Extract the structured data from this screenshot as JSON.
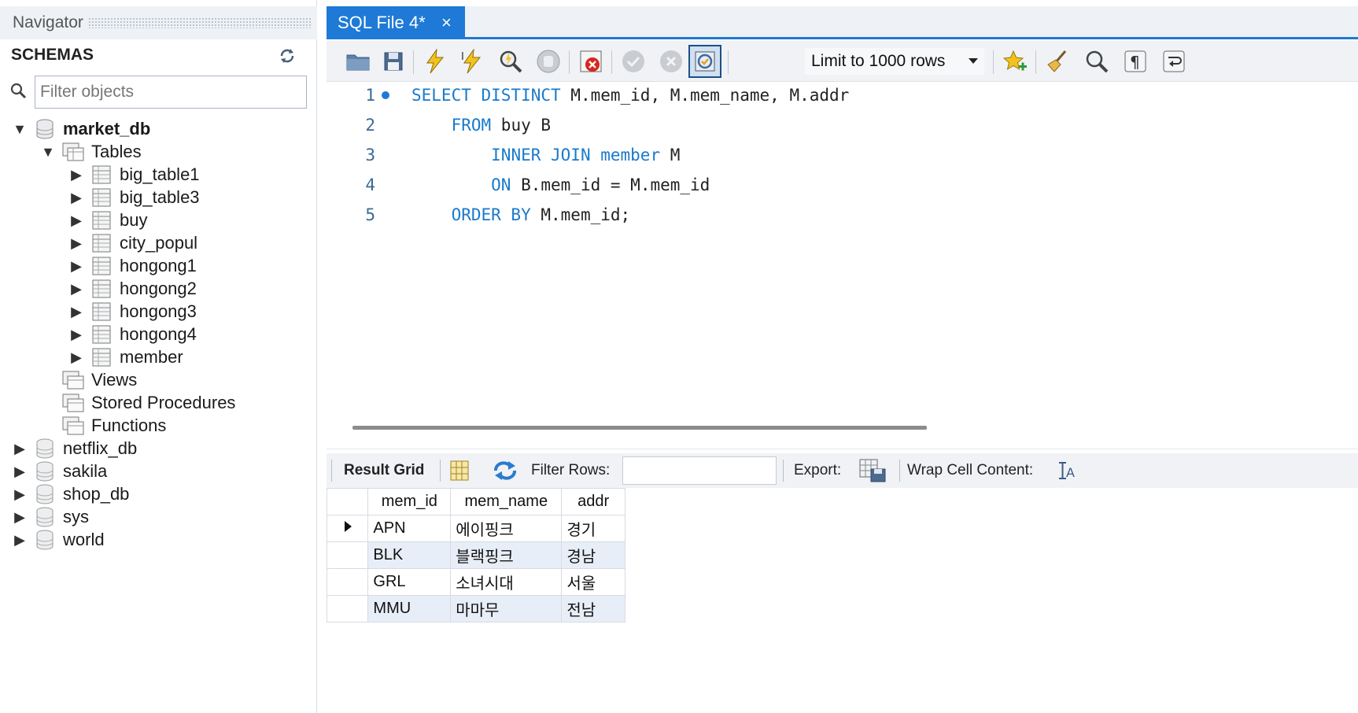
{
  "navigator": {
    "title": "Navigator",
    "schemas_label": "SCHEMAS",
    "filter_placeholder": "Filter objects",
    "tree": {
      "db_name": "market_db",
      "tables_label": "Tables",
      "tables": [
        "big_table1",
        "big_table3",
        "buy",
        "city_popul",
        "hongong1",
        "hongong2",
        "hongong3",
        "hongong4",
        "member"
      ],
      "views_label": "Views",
      "procedures_label": "Stored Procedures",
      "functions_label": "Functions",
      "other_schemas": [
        "netflix_db",
        "sakila",
        "shop_db",
        "sys",
        "world"
      ]
    }
  },
  "tab": {
    "title": "SQL File 4*",
    "close": "×"
  },
  "toolbar": {
    "limit_label": "Limit to 1000 rows",
    "icons": [
      "open-folder-icon",
      "save-icon",
      "execute-icon",
      "execute-current-icon",
      "explain-icon",
      "stop-icon",
      "toggle-error-icon",
      "commit-icon",
      "rollback-icon",
      "autocommit-icon",
      "bookmark-star-icon",
      "beautify-icon",
      "find-icon",
      "invisibles-icon",
      "wrap-icon"
    ]
  },
  "editor": {
    "lines": [
      {
        "num": "1",
        "kw": "SELECT DISTINCT",
        "rest": " M.mem_id, M.mem_name, M.addr",
        "indent": ""
      },
      {
        "num": "2",
        "kw": "FROM",
        "rest": " buy B",
        "indent": "    "
      },
      {
        "num": "3",
        "kw": "INNER JOIN member",
        "rest": " M",
        "indent": "        "
      },
      {
        "num": "4",
        "kw": "ON",
        "rest": " B.mem_id = M.mem_id",
        "indent": "        "
      },
      {
        "num": "5",
        "kw": "ORDER BY",
        "rest": " M.mem_id;",
        "indent": "    "
      }
    ]
  },
  "result_bar": {
    "result_grid_label": "Result Grid",
    "filter_rows_label": "Filter Rows:",
    "export_label": "Export:",
    "wrap_label": "Wrap Cell Content:"
  },
  "result": {
    "columns": [
      "mem_id",
      "mem_name",
      "addr"
    ],
    "rows": [
      [
        "APN",
        "에이핑크",
        "경기"
      ],
      [
        "BLK",
        "블랙핑크",
        "경남"
      ],
      [
        "GRL",
        "소녀시대",
        "서울"
      ],
      [
        "MMU",
        "마마무",
        "전남"
      ]
    ]
  },
  "colors": {
    "accent": "#1e7ad6",
    "keyword": "#1a7acb",
    "alt_row": "#e8eef8"
  }
}
